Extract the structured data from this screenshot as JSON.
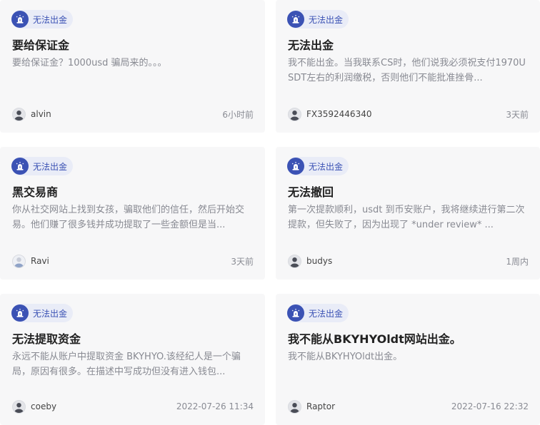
{
  "accent_color": "#3b52b4",
  "cards": [
    {
      "badge": "无法出金",
      "badge_icon": "alarm-siren-icon",
      "title": "要给保证金",
      "desc": "要给保证金？1000usd 骗局来的。。。",
      "user": "alvin",
      "avatar_icon": "user-avatar-icon",
      "time": "6小时前"
    },
    {
      "badge": "无法出金",
      "badge_icon": "alarm-siren-icon",
      "title": "无法出金",
      "desc": "我不能出金。当我联系CS时，他们说我必须祝支付1970USDT左右的利润缴税，否则他们不能批准挫骨...",
      "user": "FX3592446340",
      "avatar_icon": "user-avatar-icon",
      "time": "3天前"
    },
    {
      "badge": "无法出金",
      "badge_icon": "alarm-siren-icon",
      "title": "黑交易商",
      "desc": "你从社交网站上找到女孩，骗取他们的信任，然后开始交易。他们赚了很多钱并成功提取了一些金额但是当...",
      "user": "Ravi",
      "avatar_icon": "user-avatar-icon",
      "time": "3天前"
    },
    {
      "badge": "无法出金",
      "badge_icon": "alarm-siren-icon",
      "title": "无法撤回",
      "desc": "第一次提款顺利，usdt 到币安账户，我将继续进行第二次提款，但失败了，因为出现了 *under review* ...",
      "user": "budys",
      "avatar_icon": "user-avatar-icon",
      "time": "1周内"
    },
    {
      "badge": "无法出金",
      "badge_icon": "alarm-siren-icon",
      "title": "无法提取资金",
      "desc": "永远不能从账户中提取资金 BKYHYO.该经纪人是一个骗局，原因有很多。在描述中写成功但没有进入钱包...",
      "user": "coeby",
      "avatar_icon": "user-avatar-icon",
      "time": "2022-07-26 11:34"
    },
    {
      "badge": "无法出金",
      "badge_icon": "alarm-siren-icon",
      "title": "我不能从BKYHYOldt网站出金。",
      "desc": "我不能从BKYHYOldt出金。",
      "user": "Raptor",
      "avatar_icon": "user-avatar-icon",
      "time": "2022-07-16 22:32"
    }
  ]
}
